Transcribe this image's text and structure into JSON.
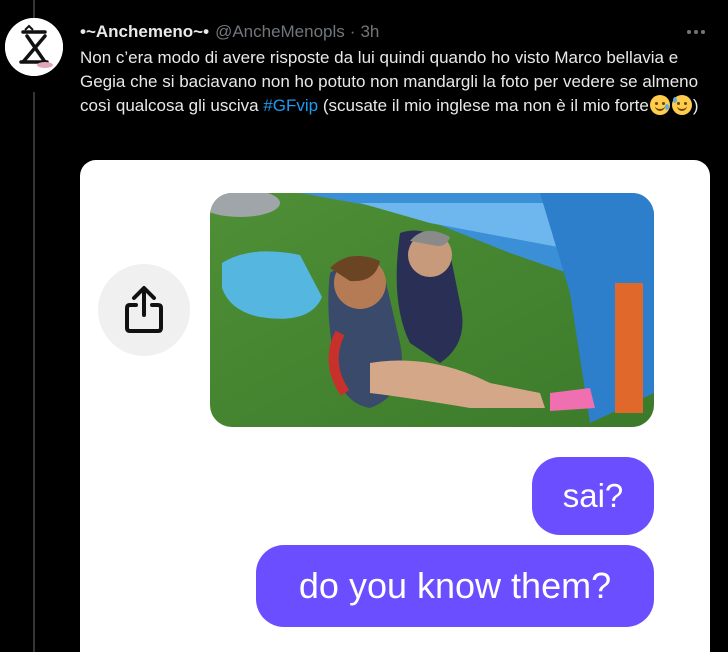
{
  "tweet": {
    "display_name": "•~Anchemeno~•",
    "handle": "@AncheMenopls",
    "separator": "·",
    "time": "3h",
    "text_before_hashtag": "Non c’era modo di avere risposte da lui quindi quando ho visto Marco bellavia e Gegia che si baciavano non ho potuto non mandargli la foto per vedere se almeno così qualcosa gli usciva ",
    "hashtag": "#GFvip",
    "text_after_hashtag": " (scusate il mio inglese ma non è il mio forte",
    "text_end": ")",
    "emojis": [
      "smiling-face-with-tear-emoji",
      "grinning-face-with-sweat-emoji"
    ]
  },
  "media": {
    "share_icon": "share-icon",
    "message_bubbles": [
      {
        "text": "sai?"
      },
      {
        "text": "do you know them?"
      }
    ]
  },
  "colors": {
    "background": "#000000",
    "text": "#e7e9ea",
    "secondary": "#71767b",
    "link": "#1d9bf0",
    "bubble": "#6b4eff"
  }
}
